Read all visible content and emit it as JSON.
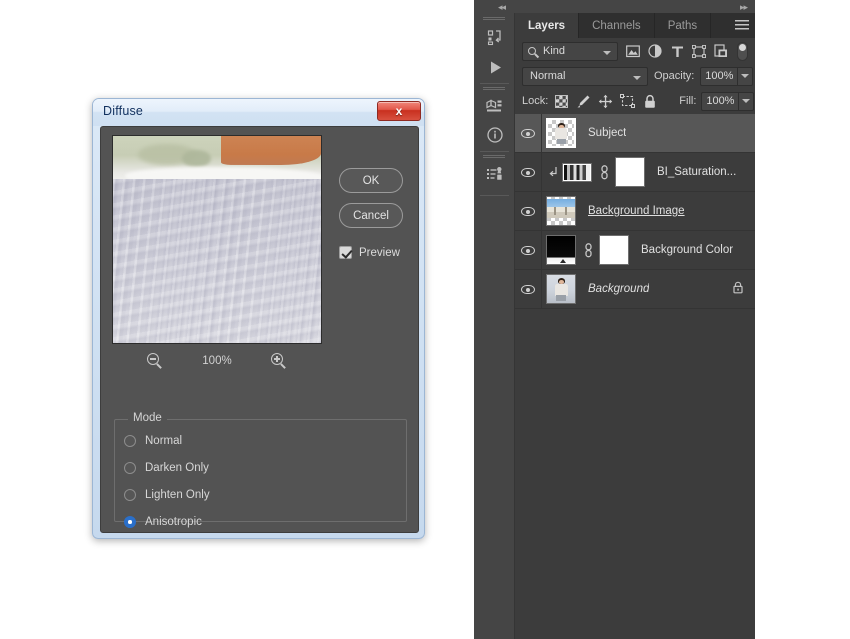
{
  "dialog": {
    "title": "Diffuse",
    "close_label": "x",
    "buttons": {
      "ok": "OK",
      "cancel": "Cancel"
    },
    "preview": {
      "label": "Preview",
      "checked": true
    },
    "zoom": {
      "value": "100%",
      "zoom_out_icon": "zoom-out-icon",
      "zoom_in_icon": "zoom-in-icon"
    },
    "mode": {
      "legend": "Mode",
      "options": [
        {
          "label": "Normal",
          "selected": false
        },
        {
          "label": "Darken Only",
          "selected": false
        },
        {
          "label": "Lighten Only",
          "selected": false
        },
        {
          "label": "Anisotropic",
          "selected": true
        }
      ]
    }
  },
  "dock": {
    "collapse_left_icon": "◂◂",
    "collapse_right_icon": "▸▸",
    "rail_icons": [
      {
        "name": "history-icon",
        "glyph": "⤴"
      },
      {
        "name": "actions-play-icon",
        "glyph": "▶"
      },
      {
        "name": "properties-3d-icon",
        "glyph": "⬚"
      },
      {
        "name": "info-icon",
        "glyph": "ⓘ"
      },
      {
        "name": "layer-comps-icon",
        "glyph": "☰"
      }
    ]
  },
  "panel": {
    "tabs": [
      {
        "label": "Layers",
        "active": true
      },
      {
        "label": "Channels",
        "active": false
      },
      {
        "label": "Paths",
        "active": false
      }
    ],
    "menu_icon": "panel-menu-icon",
    "filter": {
      "kind_label": "Kind",
      "search_icon": "search-icon",
      "icons": [
        {
          "name": "filter-pixel-icon",
          "glyph": "▣"
        },
        {
          "name": "filter-adjustment-icon",
          "glyph": "◑"
        },
        {
          "name": "filter-type-icon",
          "glyph": "T"
        },
        {
          "name": "filter-shape-icon",
          "glyph": "⬚"
        },
        {
          "name": "filter-smart-object-icon",
          "glyph": "⧉"
        }
      ],
      "toggle": "filter-enable-toggle"
    },
    "blend": {
      "mode": "Normal",
      "opacity_label": "Opacity:",
      "opacity_value": "100%"
    },
    "lock": {
      "label": "Lock:",
      "icons": [
        {
          "name": "lock-transparent-pixels-icon",
          "glyph": ""
        },
        {
          "name": "lock-image-pixels-brush-icon",
          "glyph": "✐"
        },
        {
          "name": "lock-position-move-icon",
          "glyph": "✥"
        },
        {
          "name": "lock-artboard-nesting-icon",
          "glyph": "⬚"
        },
        {
          "name": "lock-all-icon",
          "glyph": "🔒"
        }
      ],
      "fill_label": "Fill:",
      "fill_value": "100%"
    },
    "layers": [
      {
        "name": "Subject",
        "selected": true,
        "visible": true,
        "thumb_type": "person",
        "italic": false,
        "renaming": false,
        "locked": false,
        "clipped": false,
        "has_mask": false
      },
      {
        "name": "BI_Saturation...",
        "selected": false,
        "visible": true,
        "thumb_type": "adjustment",
        "italic": false,
        "renaming": false,
        "locked": false,
        "clipped": true,
        "has_mask": true
      },
      {
        "name": "Background Image",
        "selected": false,
        "visible": true,
        "thumb_type": "bgimage",
        "italic": false,
        "renaming": true,
        "locked": false,
        "clipped": false,
        "has_mask": false
      },
      {
        "name": "Background Color",
        "selected": false,
        "visible": true,
        "thumb_type": "gradient",
        "italic": false,
        "renaming": false,
        "locked": false,
        "clipped": false,
        "has_mask": true
      },
      {
        "name": "Background",
        "selected": false,
        "visible": true,
        "thumb_type": "bgfull",
        "italic": true,
        "renaming": false,
        "locked": true,
        "clipped": false,
        "has_mask": false
      }
    ]
  },
  "colors": {
    "panel_bg": "#3c3c3c",
    "dock_bg": "#3f3f3f",
    "tab_bar_bg": "#2f2f2f",
    "selected_layer_bg": "#575757",
    "dialog_body_bg": "#535353",
    "aero_frame": "#cfe0f2",
    "accent_radio": "#2a6fc9",
    "close_button": "#c8301f"
  }
}
